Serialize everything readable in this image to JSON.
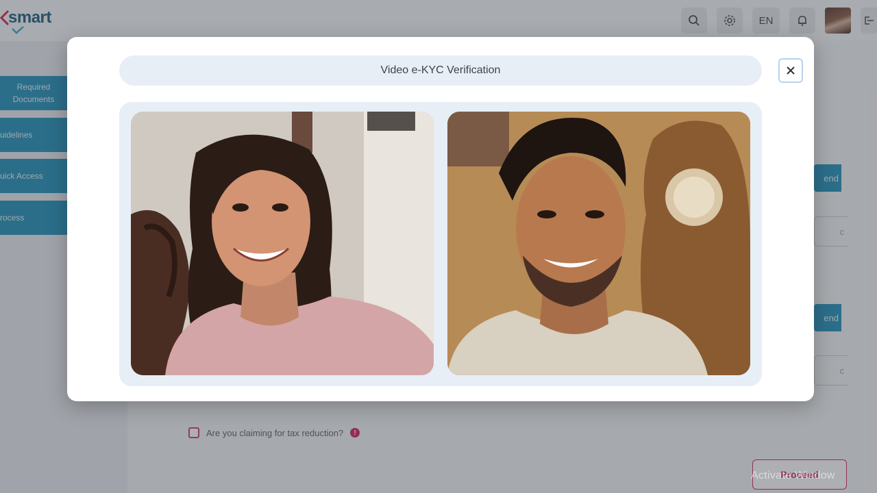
{
  "app": {
    "logo_text": "smart",
    "brand_color": "#1a5d7a",
    "accent_color": "#d2245a",
    "primary_color": "#1f8fb8"
  },
  "topbar": {
    "search_icon": "search-icon",
    "settings_icon": "gear-icon",
    "language": "EN",
    "notifications_icon": "bell-icon",
    "logout_icon": "logout-icon"
  },
  "sidebar": {
    "items": [
      {
        "label": "Required Documents"
      },
      {
        "label": "uidelines"
      },
      {
        "label": "uick Access"
      },
      {
        "label": "rocess"
      }
    ]
  },
  "main": {
    "right_buttons": [
      {
        "label": "end"
      },
      {
        "label": "c"
      },
      {
        "label": "end"
      },
      {
        "label": "c"
      }
    ],
    "tax_reduction_label": "Are you claiming for tax reduction?",
    "info_icon_text": "!",
    "proceed_label": "Proceed"
  },
  "watermark": "Activate Window",
  "modal": {
    "title": "Video e-KYC Verification",
    "close_icon": "close-icon",
    "videos": [
      {
        "name": "customer-video-feed"
      },
      {
        "name": "agent-video-feed"
      }
    ]
  }
}
